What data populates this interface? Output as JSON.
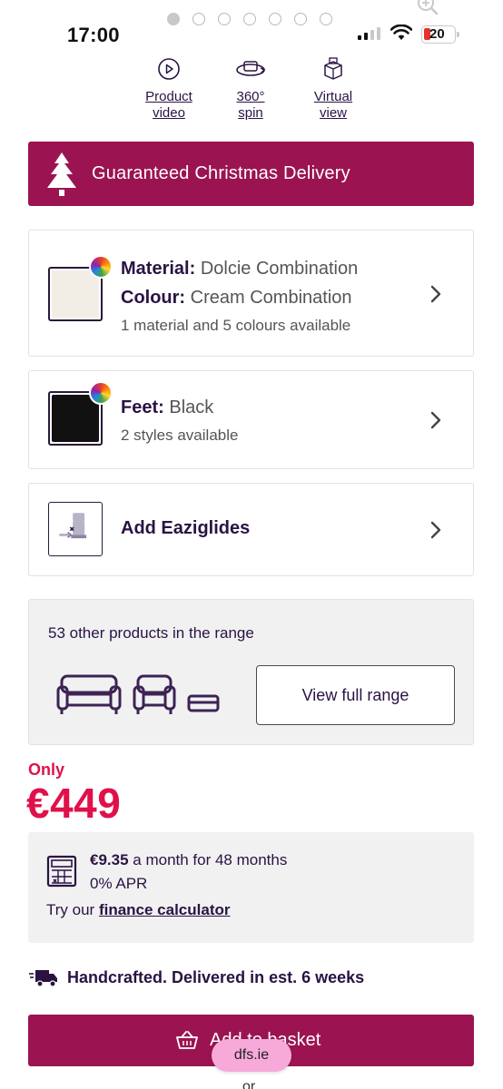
{
  "status_bar": {
    "time": "17:00",
    "battery_level": "20",
    "page_dots": 7,
    "active_dot": 0
  },
  "media_links": [
    {
      "label_line1": "Product",
      "label_line2": "video",
      "icon": "play-icon"
    },
    {
      "label_line1": "360°",
      "label_line2": "spin",
      "icon": "rotate-360-icon"
    },
    {
      "label_line1": "Virtual",
      "label_line2": "view",
      "icon": "box-3d-icon"
    }
  ],
  "banner": {
    "text": "Guaranteed Christmas Delivery",
    "icon": "christmas-tree-icon",
    "color": "#9b1451"
  },
  "options": {
    "material_label": "Material:",
    "material_value": "Dolcie Combination",
    "colour_label": "Colour:",
    "colour_value": "Cream Combination",
    "material_sub": "1 material and 5 colours available",
    "material_swatch_color": "#f2eee6",
    "feet_label": "Feet:",
    "feet_value": "Black",
    "feet_sub": "2 styles available",
    "feet_swatch_color": "#111111",
    "eaziglides_label": "Add Eaziglides"
  },
  "range": {
    "count_text": "53 other products in the range",
    "button_label": "View full range"
  },
  "price": {
    "only_label": "Only",
    "amount": "€449",
    "color": "#e0114a"
  },
  "finance": {
    "monthly_amount": "€9.35",
    "monthly_text": " a month for 48 months",
    "apr_text": "0% APR",
    "try_text": "Try our ",
    "calculator_link": "finance calculator"
  },
  "delivery": {
    "text": "Handcrafted. Delivered in est. 6 weeks"
  },
  "basket": {
    "button_label": "Add to basket",
    "url_pill": "dfs.ie",
    "or_text": "or"
  }
}
